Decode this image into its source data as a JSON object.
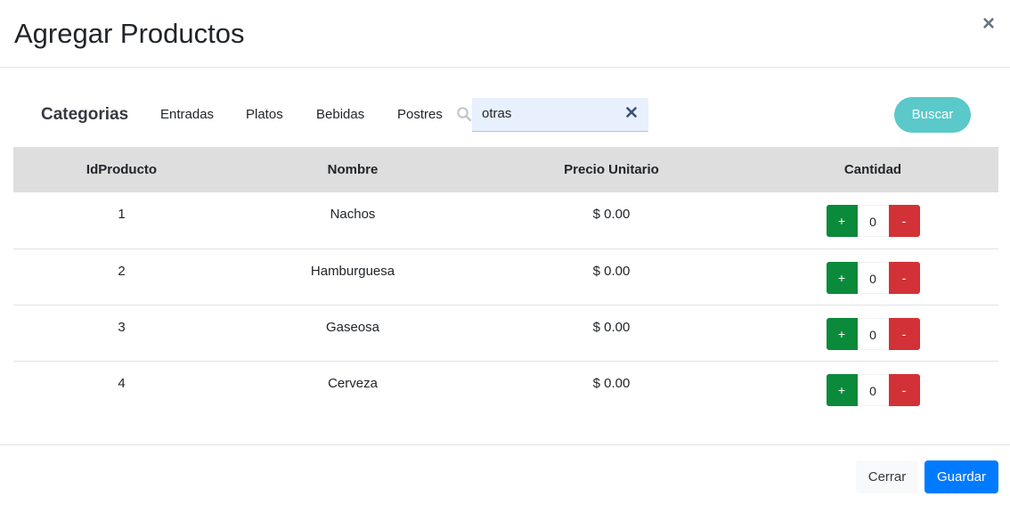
{
  "modal": {
    "title": "Agregar Productos",
    "close_glyph": "×"
  },
  "filters": {
    "label": "Categorias",
    "categories": [
      "Entradas",
      "Platos",
      "Bebidas",
      "Postres"
    ],
    "search_value": "otras",
    "search_icon": "search-icon",
    "clear_icon": "close-icon",
    "search_button": "Buscar"
  },
  "table": {
    "headers": [
      "IdProducto",
      "Nombre",
      "Precio Unitario",
      "Cantidad"
    ],
    "rows": [
      {
        "id": "1",
        "name": "Nachos",
        "price": "$ 0.00",
        "qty": "0"
      },
      {
        "id": "2",
        "name": "Hamburguesa",
        "price": "$ 0.00",
        "qty": "0"
      },
      {
        "id": "3",
        "name": "Gaseosa",
        "price": "$ 0.00",
        "qty": "0"
      },
      {
        "id": "4",
        "name": "Cerveza",
        "price": "$ 0.00",
        "qty": "0"
      }
    ],
    "plus_label": "+",
    "minus_label": "-"
  },
  "footer": {
    "close_button": "Cerrar",
    "save_button": "Guardar"
  },
  "colors": {
    "primary": "#007bff",
    "success": "#0a8a3a",
    "danger": "#d23237",
    "info": "#5bc8c9",
    "header_bg": "#dedede"
  }
}
